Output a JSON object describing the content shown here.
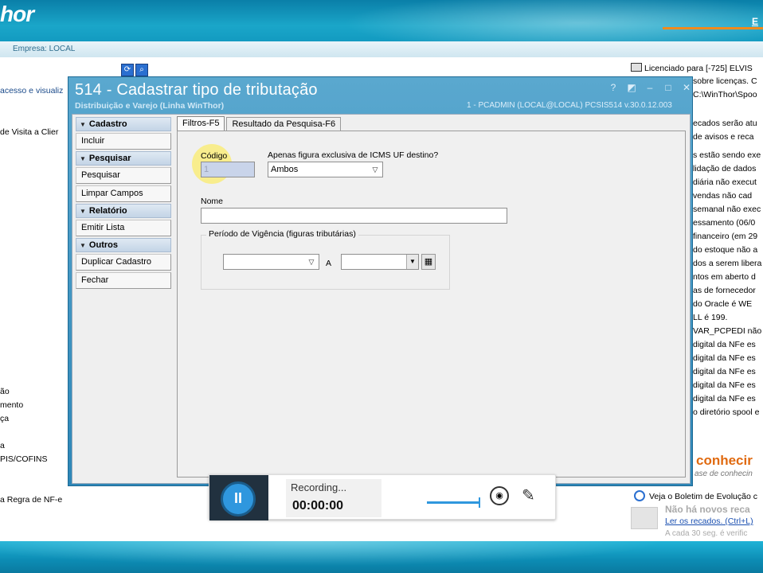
{
  "background": {
    "logo_text": "hor",
    "top_link": "E",
    "company": "Empresa: LOCAL",
    "nav_items": [
      {
        "text": "acesso e visualiz",
        "blue": true
      },
      {
        "text": "de Visita a Clier",
        "blue": false
      },
      {
        "text": "ão",
        "blue": false
      },
      {
        "text": "mento",
        "blue": false
      },
      {
        "text": "ça",
        "blue": false
      },
      {
        "text": "a",
        "blue": false
      },
      {
        "text": "PIS/COFINS",
        "blue": false
      },
      {
        "text": "a Regra de NF-e",
        "blue": false
      }
    ],
    "licenca": "Licenciado para [-725] ELVIS",
    "right_lines": [
      "sobre licenças. C",
      "C:\\WinThor\\Spoo",
      "",
      "ecados serão atu",
      " de avisos e reca",
      "s estão sendo exe",
      "lidação de dados",
      "diária não execut",
      " vendas não cad",
      "semanal não exec",
      "essamento (06/0",
      "financeiro (em 29",
      "do estoque não a",
      "dos a serem libera",
      "ntos em aberto d",
      "as de fornecedor",
      " do Oracle é WE",
      "LL é 199.",
      "VAR_PCPEDI não e",
      " digital da NFe es",
      " digital da NFe es",
      " digital da NFe es",
      " digital da NFe es",
      " digital da NFe es",
      "o diretório spool e"
    ],
    "conhecimento": "conhecir",
    "conhecimento_sub": "ase de conhecin",
    "boletim": "Veja o Boletim de Evolução c",
    "recados_none": "Não há novos reca",
    "ler_recados": "Ler os recados. (Ctrl+L)",
    "cada_30": "A cada 30 seg. é verific"
  },
  "window": {
    "title": "514 - Cadastrar tipo de tributação",
    "subtitle": "Distribuição e Varejo (Linha WinThor)",
    "user_info": "1 - PCADMIN (LOCAL@LOCAL)   PCSIS514  v.30.0.12.003",
    "controls": [
      "?",
      "◩",
      "–",
      "□",
      "✕"
    ]
  },
  "menu": {
    "groups": [
      {
        "label": "Cadastro",
        "items": [
          "Incluir"
        ]
      },
      {
        "label": "Pesquisar",
        "items": [
          "Pesquisar",
          "Limpar Campos"
        ]
      },
      {
        "label": "Relatório",
        "items": [
          "Emitir Lista"
        ]
      },
      {
        "label": "Outros",
        "items": [
          "Duplicar Cadastro",
          "Fechar"
        ]
      }
    ]
  },
  "tabs": [
    {
      "label": "Filtros-F5",
      "active": true
    },
    {
      "label": "Resultado da Pesquisa-F6",
      "active": false
    }
  ],
  "form": {
    "codigo_label": "Código",
    "codigo_value": "1",
    "icms_label": "Apenas figura exclusiva de ICMS UF destino?",
    "icms_value": "Ambos",
    "nome_label": "Nome",
    "nome_value": "",
    "vigencia_label": "Período de Vigência (figuras tributárias)",
    "date_from": "",
    "date_sep": "A",
    "date_to": ""
  },
  "recorder": {
    "status": "Recording...",
    "time": "00:00:00",
    "colors": {
      "accent": "#2f97de",
      "dark": "#21313f"
    }
  },
  "colors": {
    "header_teal": "#0c8fb8",
    "window_blue": "#2d86b7",
    "orange": "#f08a1c"
  }
}
